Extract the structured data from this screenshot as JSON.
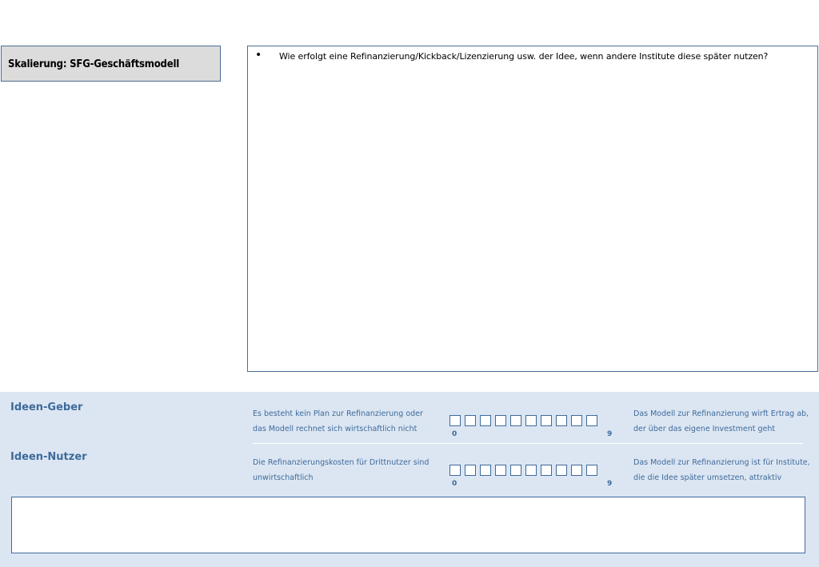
{
  "title": "Skalierung: SFG-Geschäftsmodell",
  "question": "Wie erfolgt eine Refinanzierung/Kickback/Lizenzierung usw. der Idee, wenn andere Institute diese später nutzen?",
  "rows": [
    {
      "label": "Ideen-Geber",
      "left_text": "Es besteht kein Plan zur Refinanzierung oder das Modell rechnet sich wirtschaftlich nicht",
      "right_text": "Das Modell zur Refinanzierung wirft Ertrag ab, der über das eigene Investment geht",
      "scale_min": "0",
      "scale_max": "9"
    },
    {
      "label": "Ideen-Nutzer",
      "left_text": "Die Refinanzierungskosten für Drittnutzer sind unwirtschaftlich",
      "right_text": "Das Modell zur Refinanzierung ist für Institute, die die Idee später umsetzen, attraktiv",
      "scale_min": "0",
      "scale_max": "9"
    }
  ],
  "notes_value": ""
}
